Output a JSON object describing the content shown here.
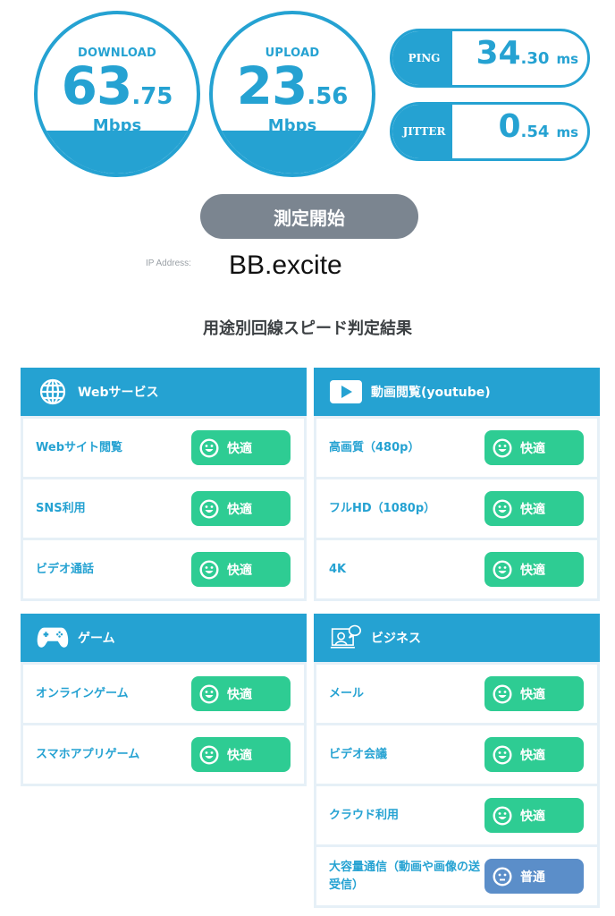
{
  "speed": {
    "download": {
      "label": "DOWNLOAD",
      "int": "63",
      "dec": ".75",
      "unit": "Mbps"
    },
    "upload": {
      "label": "UPLOAD",
      "int": "23",
      "dec": ".56",
      "unit": "Mbps"
    },
    "ping": {
      "label": "PING",
      "int": "34",
      "dec": ".30",
      "unit": "ms"
    },
    "jitter": {
      "label": "JITTER",
      "int": "0",
      "dec": ".54",
      "unit": "ms"
    }
  },
  "start_button": "測定開始",
  "ip": {
    "label": "IP Address:",
    "value": "BB.excite"
  },
  "results_title": "用途別回線スピード判定結果",
  "colors": {
    "accent": "#25a2d2",
    "good": "#2ecc93",
    "normal": "#5b8ec9",
    "button": "#7b8590"
  },
  "categories": [
    {
      "title": "Webサービス",
      "icon": "globe-icon",
      "items": [
        {
          "name": "Webサイト閲覧",
          "status": "快適",
          "face": "smile"
        },
        {
          "name": "SNS利用",
          "status": "快適",
          "face": "smile"
        },
        {
          "name": "ビデオ通話",
          "status": "快適",
          "face": "smile"
        }
      ]
    },
    {
      "title": "動画閲覧(youtube)",
      "icon": "play-icon",
      "items": [
        {
          "name": "高画質（480p）",
          "status": "快適",
          "face": "smile"
        },
        {
          "name": "フルHD（1080p）",
          "status": "快適",
          "face": "smile"
        },
        {
          "name": "4K",
          "status": "快適",
          "face": "smile"
        }
      ]
    },
    {
      "title": "ゲーム",
      "icon": "gamepad-icon",
      "items": [
        {
          "name": "オンラインゲーム",
          "status": "快適",
          "face": "smile"
        },
        {
          "name": "スマホアプリゲーム",
          "status": "快適",
          "face": "smile"
        }
      ]
    },
    {
      "title": "ビジネス",
      "icon": "video-conference-icon",
      "items": [
        {
          "name": "メール",
          "status": "快適",
          "face": "smile"
        },
        {
          "name": "ビデオ会議",
          "status": "快適",
          "face": "smile"
        },
        {
          "name": "クラウド利用",
          "status": "快適",
          "face": "smile"
        },
        {
          "name": "大容量通信（動画や画像の送受信）",
          "status": "普通",
          "face": "neutral"
        }
      ]
    }
  ]
}
